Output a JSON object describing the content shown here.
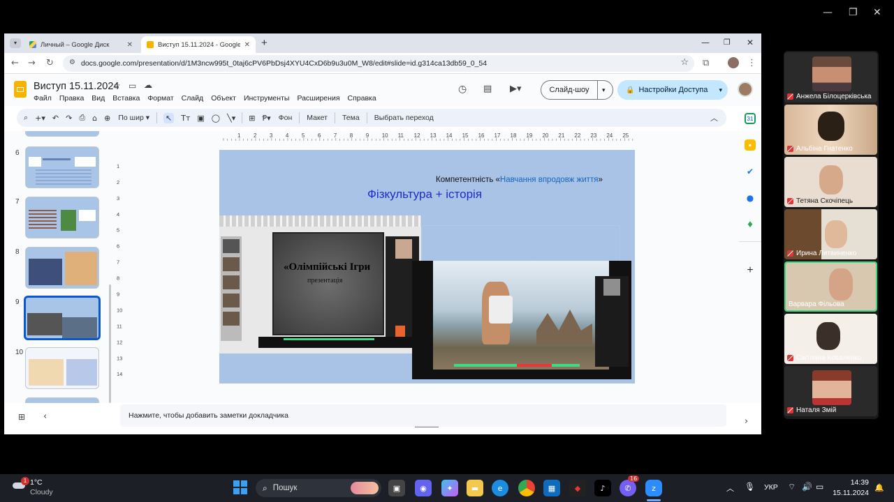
{
  "window_controls": {
    "minimize": "—",
    "maximize": "❐",
    "close": "✕"
  },
  "browser": {
    "tabs": [
      {
        "label": "Личный – Google Диск",
        "active": false
      },
      {
        "label": "Виступ 15.11.2024 - Google Пр",
        "active": true
      }
    ],
    "new_tab": "+",
    "url": "docs.google.com/presentation/d/1M3ncw995t_0taj6cPV6PbDsj4XYU4CxD6b9u3u0M_W8/edit#slide=id.g314ca13db59_0_54"
  },
  "app": {
    "title": "Виступ 15.11.2024",
    "menu": [
      "Файл",
      "Правка",
      "Вид",
      "Вставка",
      "Формат",
      "Слайд",
      "Объект",
      "Инструменты",
      "Расширения",
      "Справка"
    ],
    "slideshow_button": "Слайд-шоу",
    "share_button": "Настройки Доступа",
    "toolbar": {
      "zoom": "По шир",
      "background": "Фон",
      "layout": "Макет",
      "theme": "Тема",
      "transition": "Выбрать переход"
    },
    "ruler_labels": [
      "1",
      "2",
      "3",
      "4",
      "5",
      "6",
      "7",
      "8",
      "9",
      "10",
      "11",
      "12",
      "13",
      "14",
      "15",
      "16",
      "17",
      "18",
      "19",
      "20",
      "21",
      "22",
      "23",
      "24",
      "25"
    ],
    "vruler_labels": [
      "1",
      "2",
      "3",
      "4",
      "5",
      "6",
      "7",
      "8",
      "9",
      "10",
      "11",
      "12",
      "13",
      "14"
    ]
  },
  "slides": [
    {
      "number": "6"
    },
    {
      "number": "7"
    },
    {
      "number": "8"
    },
    {
      "number": "9",
      "selected": true
    },
    {
      "number": "10"
    }
  ],
  "current_slide": {
    "competence_prefix": "Компетентність  «",
    "competence_link": "Навчання впродовж життя",
    "competence_suffix": "»",
    "title": "Фізкультура + історія",
    "embedded_title": "«Олімпійські Ігри",
    "embedded_subtitle": "презентація"
  },
  "notes_placeholder": "Нажмите, чтобы добавить заметки докладчика",
  "participants": [
    {
      "name": "Анжела Білоцерківська",
      "muted": true
    },
    {
      "name": "Альбіна Гнатенко",
      "muted": true
    },
    {
      "name": "Тетяна Скочіпець",
      "muted": true
    },
    {
      "name": "Ирина Литвиненко",
      "muted": true
    },
    {
      "name": "Варвара Фільова",
      "muted": false,
      "active": true
    },
    {
      "name": "Світлана Коваленко",
      "muted": true
    },
    {
      "name": "Наталя Змій",
      "muted": true
    }
  ],
  "taskbar": {
    "weather_temp": "1°C",
    "weather_desc": "Cloudy",
    "weather_badge": "1",
    "search_placeholder": "Пошук",
    "viber_badge": "16",
    "language": "УКР",
    "time": "14:39",
    "date": "15.11.2024"
  },
  "colors": {
    "accent": "#0b57d0",
    "share_bg": "#c2e7ff",
    "active_speaker": "#3ddc84"
  }
}
